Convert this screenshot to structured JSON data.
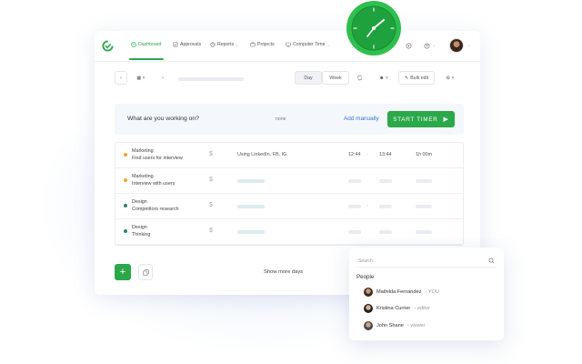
{
  "nav": {
    "items": [
      {
        "label": "Dashboard",
        "active": true
      },
      {
        "label": "Approvals"
      },
      {
        "label": "Reports"
      },
      {
        "label": "Projects"
      },
      {
        "label": "Computer Time"
      }
    ],
    "accent": "#2ba84a"
  },
  "toolbar": {
    "day_label": "Day",
    "week_label": "Week",
    "bulk_edit_label": "Bulk edit"
  },
  "timer": {
    "prompt": "What are you working on?",
    "project": "none",
    "add_manually": "Add manually",
    "start_label": "START TIMER"
  },
  "entries": [
    {
      "project": "Marketing",
      "task": "Find users for interview",
      "billable": "$",
      "description": "Using LinkedIn, FB, IG",
      "start": "12:44",
      "end": "13:44",
      "duration": "1h 00m",
      "dot_color": "#f5a623"
    },
    {
      "project": "Marketing",
      "task": "Interview with users",
      "billable": "$",
      "dot_color": "#f5a623"
    },
    {
      "project": "Design",
      "task": "Competitors research",
      "billable": "$",
      "dot_color": "#2a8a5c"
    },
    {
      "project": "Design",
      "task": "Thinking",
      "billable": "$",
      "dot_color": "#2a8a5c"
    }
  ],
  "footer": {
    "show_more": "Show more days"
  },
  "people_dropdown": {
    "search_placeholder": "Search...",
    "title": "People",
    "people": [
      {
        "name": "Mathilda Fernandez",
        "role": "- YOU"
      },
      {
        "name": "Kristina Currier",
        "role": "- editor"
      },
      {
        "name": "John Shane",
        "role": "- viewer"
      }
    ]
  }
}
